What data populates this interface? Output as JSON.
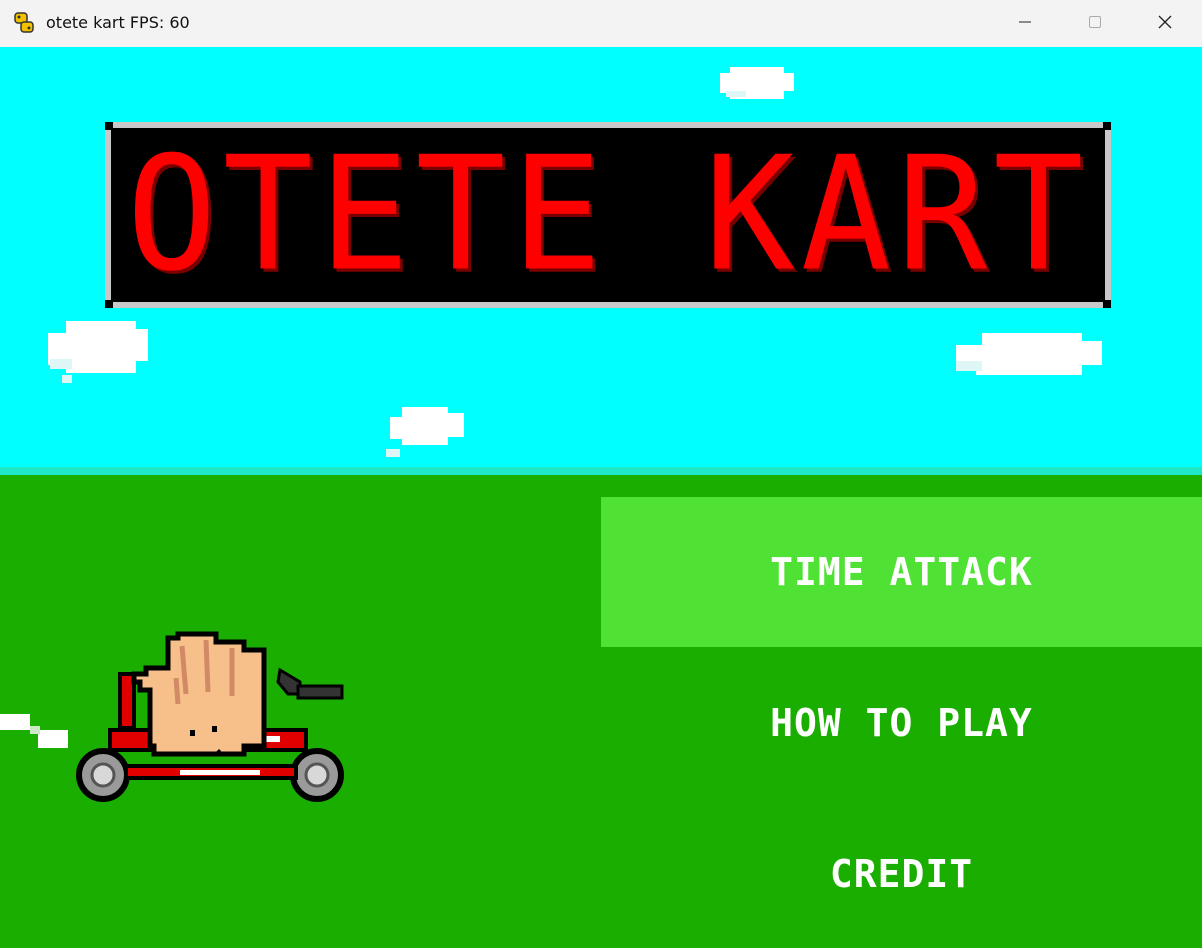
{
  "window": {
    "title": "otete kart FPS: 60",
    "icon": "python-icon",
    "controls": [
      "minimize-icon",
      "maximize-icon",
      "close-icon"
    ]
  },
  "game": {
    "logo_text": "OTETE KART",
    "menu": [
      {
        "label": "TIME ATTACK",
        "selected": true
      },
      {
        "label": "HOW TO PLAY",
        "selected": false
      },
      {
        "label": "CREDIT",
        "selected": false
      }
    ],
    "colors": {
      "sky": "#00ffff",
      "grass": "#1aae00",
      "menu_highlight": "#4fe234",
      "logo_text": "#ff0000",
      "logo_background": "#000000"
    }
  }
}
